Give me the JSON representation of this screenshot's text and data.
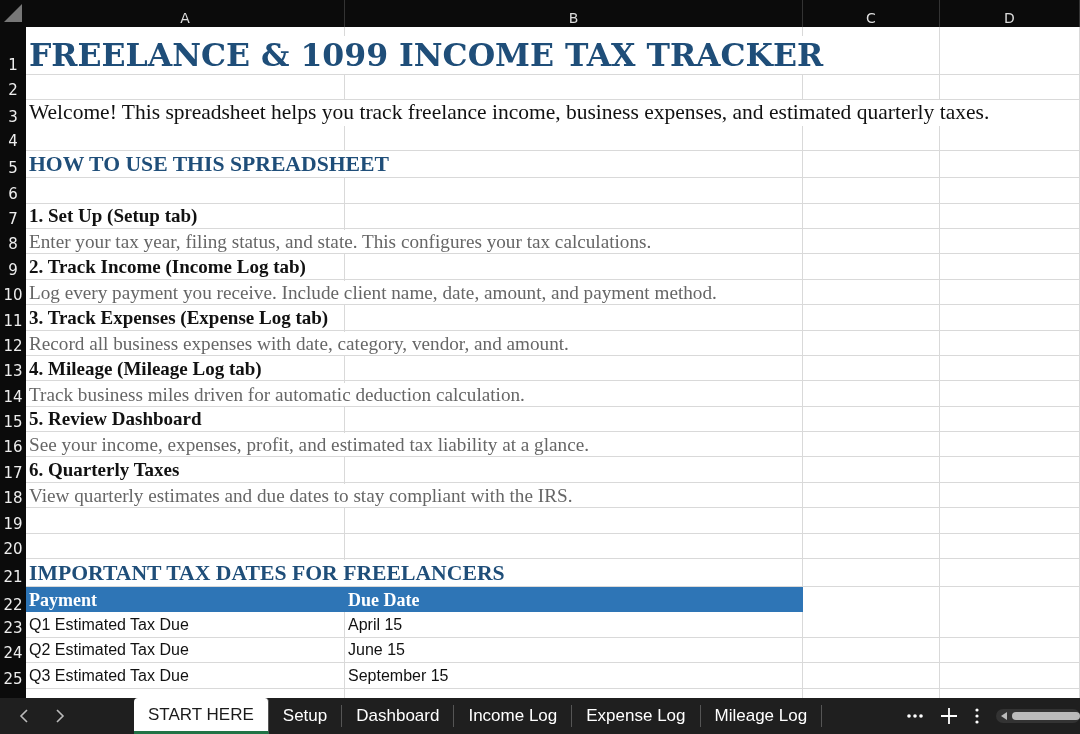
{
  "columns": [
    "A",
    "B",
    "C",
    "D"
  ],
  "rows": [
    {
      "number": "1",
      "kind": "title",
      "text": "FREELANCE & 1099 INCOME TAX TRACKER"
    },
    {
      "number": "2",
      "kind": "blank"
    },
    {
      "number": "3",
      "kind": "intro",
      "text": "Welcome! This spreadsheet helps you track freelance income, business expenses, and estimated quarterly taxes."
    },
    {
      "number": "4",
      "kind": "blank"
    },
    {
      "number": "5",
      "kind": "heading",
      "text": "HOW TO USE THIS SPREADSHEET"
    },
    {
      "number": "6",
      "kind": "blank"
    },
    {
      "number": "7",
      "kind": "step",
      "text": "1. Set Up (Setup tab)"
    },
    {
      "number": "8",
      "kind": "desc",
      "text": "Enter your tax year, filing status, and state. This configures your tax calculations."
    },
    {
      "number": "9",
      "kind": "step",
      "text": "2. Track Income (Income Log tab)"
    },
    {
      "number": "10",
      "kind": "desc",
      "text": "Log every payment you receive. Include client name, date, amount, and payment method."
    },
    {
      "number": "11",
      "kind": "step",
      "text": "3. Track Expenses (Expense Log tab)"
    },
    {
      "number": "12",
      "kind": "desc",
      "text": "Record all business expenses with date, category, vendor, and amount."
    },
    {
      "number": "13",
      "kind": "step",
      "text": "4. Mileage (Mileage Log tab)"
    },
    {
      "number": "14",
      "kind": "desc",
      "text": "Track business miles driven for automatic deduction calculation."
    },
    {
      "number": "15",
      "kind": "step",
      "text": "5. Review Dashboard"
    },
    {
      "number": "16",
      "kind": "desc",
      "text": "See your income, expenses, profit, and estimated tax liability at a glance."
    },
    {
      "number": "17",
      "kind": "step",
      "text": "6. Quarterly Taxes"
    },
    {
      "number": "18",
      "kind": "desc",
      "text": "View quarterly estimates and due dates to stay compliant with the IRS."
    },
    {
      "number": "19",
      "kind": "blank"
    },
    {
      "number": "20",
      "kind": "blank"
    },
    {
      "number": "21",
      "kind": "heading2",
      "text": "IMPORTANT TAX DATES FOR FREELANCERS"
    },
    {
      "number": "22",
      "kind": "table-header",
      "cells": [
        "Payment",
        "Due Date"
      ]
    },
    {
      "number": "23",
      "kind": "table-row",
      "cells": [
        "Q1 Estimated Tax Due",
        "April 15"
      ]
    },
    {
      "number": "24",
      "kind": "table-row",
      "cells": [
        "Q2 Estimated Tax Due",
        "June 15"
      ]
    },
    {
      "number": "25",
      "kind": "table-row",
      "cells": [
        "Q3 Estimated Tax Due",
        "September 15"
      ]
    }
  ],
  "sheet_tabs": [
    {
      "label": "START HERE",
      "selected": true
    },
    {
      "label": "Setup",
      "selected": false
    },
    {
      "label": "Dashboard",
      "selected": false
    },
    {
      "label": "Income Log",
      "selected": false
    },
    {
      "label": "Expense Log",
      "selected": false
    },
    {
      "label": "Mileage Log",
      "selected": false
    }
  ]
}
